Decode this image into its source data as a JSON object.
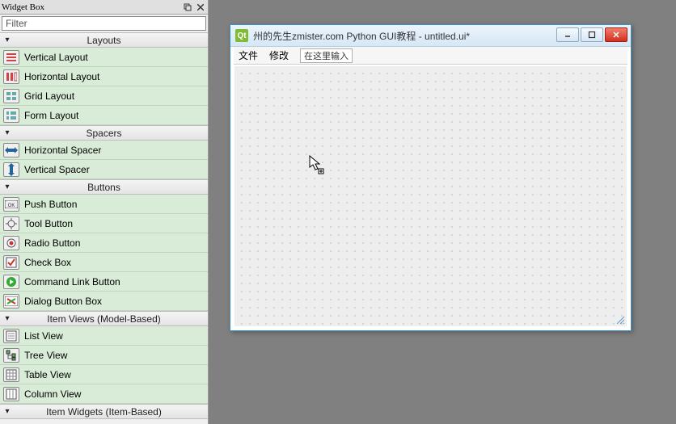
{
  "panel": {
    "title": "Widget Box",
    "filter_placeholder": "Filter",
    "sections": {
      "layouts": {
        "label": "Layouts",
        "items": [
          "Vertical Layout",
          "Horizontal Layout",
          "Grid Layout",
          "Form Layout"
        ]
      },
      "spacers": {
        "label": "Spacers",
        "items": [
          "Horizontal Spacer",
          "Vertical Spacer"
        ]
      },
      "buttons": {
        "label": "Buttons",
        "items": [
          "Push Button",
          "Tool Button",
          "Radio Button",
          "Check Box",
          "Command Link Button",
          "Dialog Button Box"
        ]
      },
      "item_views": {
        "label": "Item Views (Model-Based)",
        "items": [
          "List View",
          "Tree View",
          "Table View",
          "Column View"
        ]
      },
      "item_widgets": {
        "label": "Item Widgets (Item-Based)"
      }
    }
  },
  "designer": {
    "title": "州的先生zmister.com Python GUI教程 - untitled.ui*",
    "menu": {
      "file": "文件",
      "edit": "修改",
      "hint": "在这里输入"
    }
  }
}
